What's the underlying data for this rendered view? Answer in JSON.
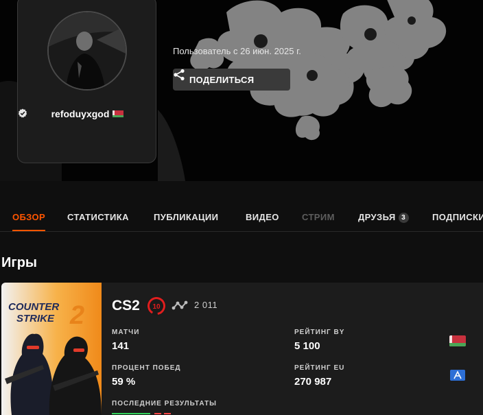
{
  "profile": {
    "username": "refoduyxgod",
    "joined_text": "Пользователь с 26 июн. 2025 г.",
    "share_label": "ПОДЕЛИТЬСЯ"
  },
  "tabs": [
    {
      "label": "ОБЗОР",
      "state": "active"
    },
    {
      "label": "СТАТИСТИКА",
      "state": "normal"
    },
    {
      "label": "ПУБЛИКАЦИИ",
      "state": "normal"
    },
    {
      "label": "ВИДЕО",
      "state": "normal"
    },
    {
      "label": "СТРИМ",
      "state": "disabled"
    },
    {
      "label": "ДРУЗЬЯ",
      "state": "normal",
      "badge": "3"
    },
    {
      "label": "ПОДПИСКИ",
      "state": "normal"
    }
  ],
  "games_section": {
    "title": "Игры"
  },
  "game": {
    "cover_title_line1": "COUNTER",
    "cover_title_line2": "STRIKE",
    "cover_number": "2",
    "name": "CS2",
    "level": "10",
    "elo": "2 011",
    "stats": {
      "matches_label": "МАТЧИ",
      "matches_value": "141",
      "winrate_label": "ПРОЦЕНТ ПОБЕД",
      "winrate_value": "59 %",
      "rating_by_label": "РЕЙТИНГ BY",
      "rating_by_value": "5 100",
      "rating_eu_label": "РЕЙТИНГ EU",
      "rating_eu_value": "270 987",
      "recent_label": "ПОСЛЕДНИЕ РЕЗУЛЬТАТЫ"
    }
  },
  "icons": {
    "verified": "verified-badge-icon",
    "flag": "belarus-flag-icon",
    "share": "share-icon",
    "elo": "elo-chart-icon",
    "eu": "eu-region-icon"
  },
  "colors": {
    "accent": "#ff5500",
    "level_ring": "#e01e1e",
    "card_bg": "#1c1c1c",
    "page_bg": "#0f0f0f"
  }
}
